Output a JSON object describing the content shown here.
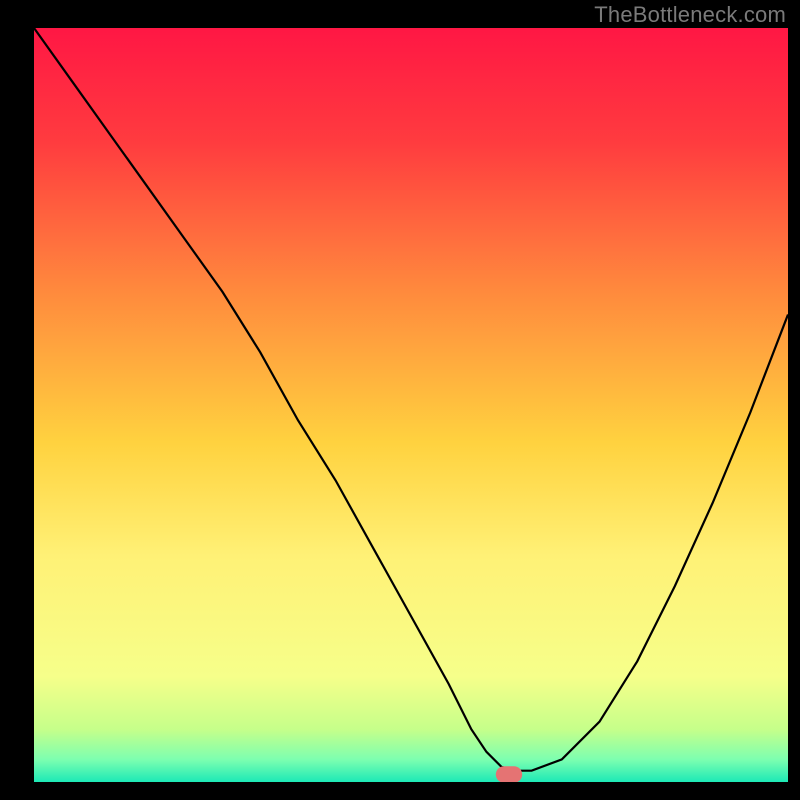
{
  "watermark": "TheBottleneck.com",
  "chart_data": {
    "type": "line",
    "title": "",
    "xlabel": "",
    "ylabel": "",
    "xlim": [
      0,
      100
    ],
    "ylim": [
      0,
      100
    ],
    "background": {
      "type": "vertical-gradient",
      "stops": [
        {
          "pos": 0,
          "color": "#ff1744"
        },
        {
          "pos": 15,
          "color": "#ff3b3f"
        },
        {
          "pos": 35,
          "color": "#ff8a3d"
        },
        {
          "pos": 55,
          "color": "#ffd23f"
        },
        {
          "pos": 70,
          "color": "#fff176"
        },
        {
          "pos": 86,
          "color": "#f6ff8a"
        },
        {
          "pos": 93,
          "color": "#c6ff8a"
        },
        {
          "pos": 97,
          "color": "#7dffb0"
        },
        {
          "pos": 100,
          "color": "#1de9b6"
        }
      ]
    },
    "series": [
      {
        "name": "bottleneck-curve",
        "color": "#000000",
        "width": 2.2,
        "x": [
          0,
          5,
          10,
          15,
          20,
          25,
          30,
          35,
          40,
          45,
          50,
          55,
          58,
          60,
          62,
          64,
          66,
          70,
          75,
          80,
          85,
          90,
          95,
          100
        ],
        "y": [
          100,
          93,
          86,
          79,
          72,
          65,
          57,
          48,
          40,
          31,
          22,
          13,
          7,
          4,
          2,
          1.5,
          1.5,
          3,
          8,
          16,
          26,
          37,
          49,
          62
        ]
      }
    ],
    "marker": {
      "name": "sweet-spot",
      "shape": "pill",
      "x": 63,
      "y": 1.0,
      "color": "#e57373",
      "width": 3.5,
      "height": 2.2
    }
  }
}
